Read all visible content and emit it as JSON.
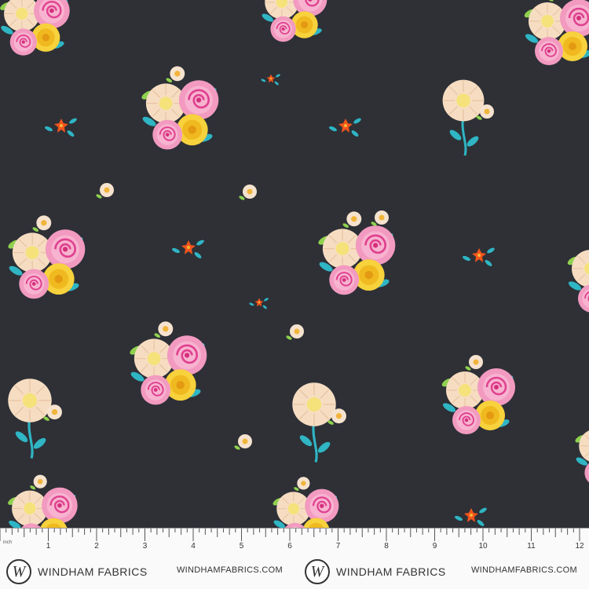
{
  "fabric": {
    "background": "#2e3036",
    "motif_icons": [
      "rose-bouquet",
      "daisy",
      "rose",
      "small-orange-flower",
      "small-white-flower",
      "leaf-sprig"
    ]
  },
  "ruler": {
    "unit_label": "inch",
    "numbers": [
      "1",
      "2",
      "3",
      "4",
      "5",
      "6",
      "7",
      "8",
      "9",
      "10",
      "11",
      "12"
    ],
    "brand_name": "WINDHAM FABRICS",
    "brand_url": "WINDHAMFABRICS.COM",
    "logo_letter": "W"
  }
}
